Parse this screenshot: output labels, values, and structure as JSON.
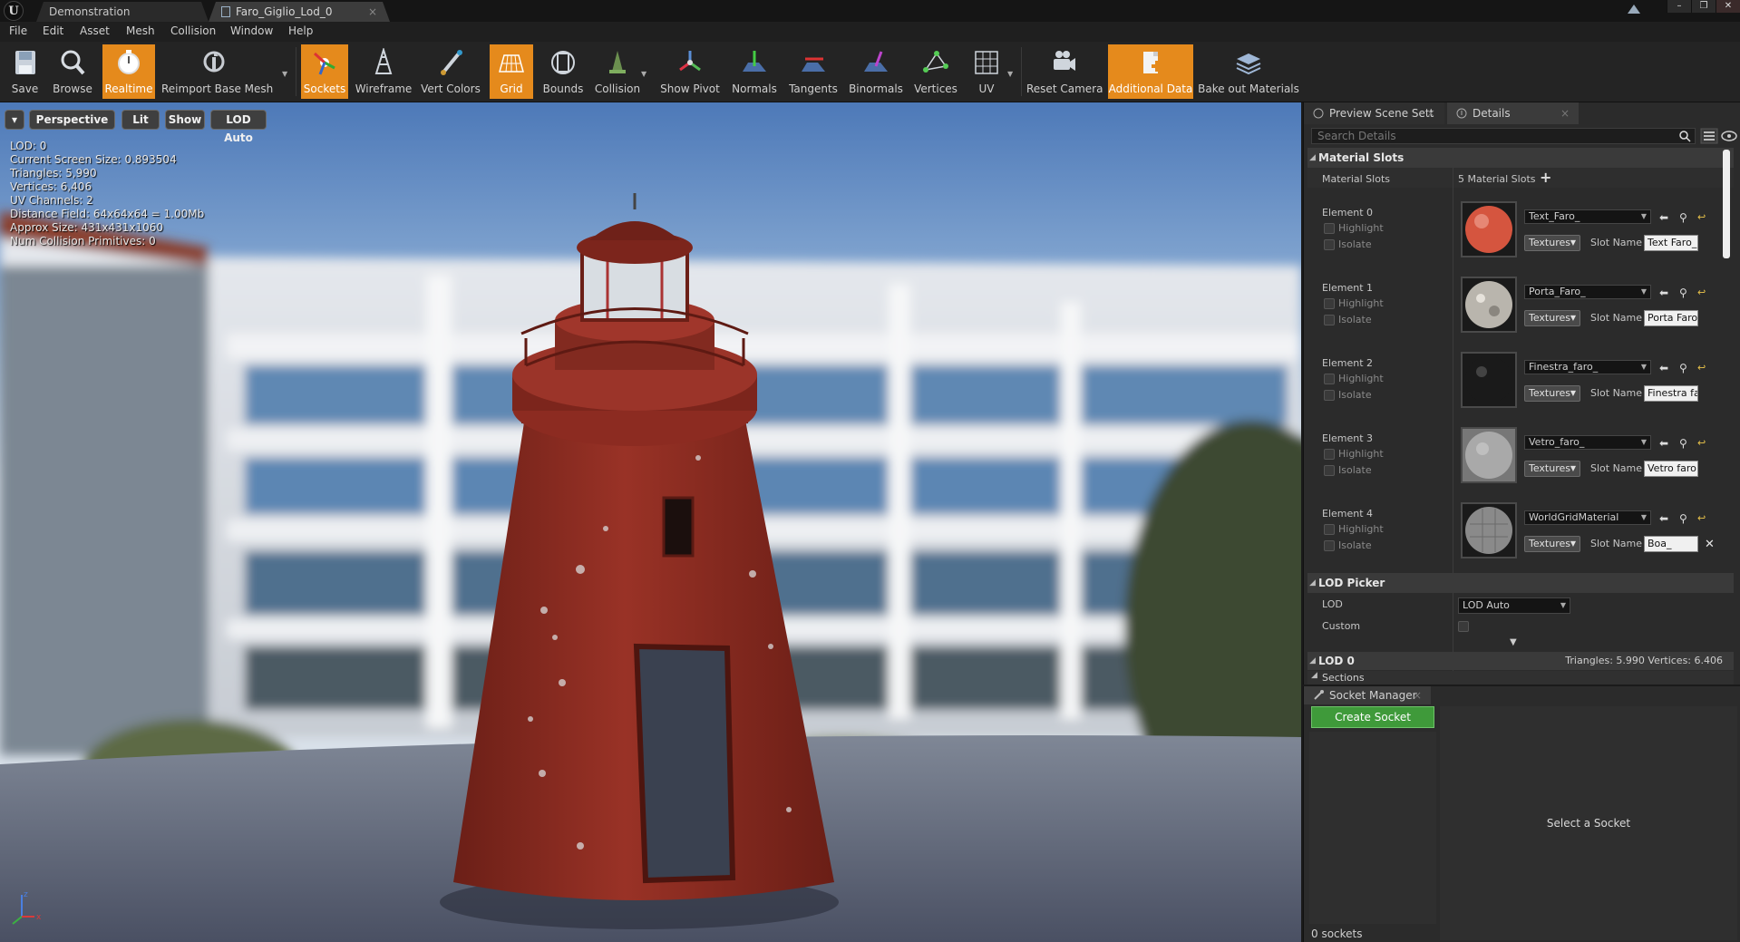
{
  "titlebar": {
    "tabs": [
      {
        "label": "Demonstration"
      },
      {
        "label": "Faro_Giglio_Lod_0"
      }
    ],
    "close_glyph": "×"
  },
  "menu": [
    "File",
    "Edit",
    "Asset",
    "Mesh",
    "Collision",
    "Window",
    "Help"
  ],
  "toolbar": {
    "buttons": [
      {
        "label": "Save",
        "icon": "save-icon",
        "active": false
      },
      {
        "label": "Browse",
        "icon": "browse-icon",
        "active": false
      },
      {
        "label": "Realtime",
        "icon": "realtime-icon",
        "active": true
      },
      {
        "label": "Reimport Base Mesh",
        "icon": "reimport-icon",
        "active": false
      },
      {
        "label": "Sockets",
        "icon": "sockets-icon",
        "active": true
      },
      {
        "label": "Wireframe",
        "icon": "wireframe-icon",
        "active": false
      },
      {
        "label": "Vert Colors",
        "icon": "vert-colors-icon",
        "active": false
      },
      {
        "label": "Grid",
        "icon": "grid-icon",
        "active": true
      },
      {
        "label": "Bounds",
        "icon": "bounds-icon",
        "active": false
      },
      {
        "label": "Collision",
        "icon": "collision-icon",
        "active": false
      },
      {
        "label": "Show Pivot",
        "icon": "pivot-icon",
        "active": false
      },
      {
        "label": "Normals",
        "icon": "normals-icon",
        "active": false
      },
      {
        "label": "Tangents",
        "icon": "tangents-icon",
        "active": false
      },
      {
        "label": "Binormals",
        "icon": "binormals-icon",
        "active": false
      },
      {
        "label": "Vertices",
        "icon": "vertices-icon",
        "active": false
      },
      {
        "label": "UV",
        "icon": "uv-icon",
        "active": false
      },
      {
        "label": "Reset Camera",
        "icon": "camera-icon",
        "active": false
      },
      {
        "label": "Additional Data",
        "icon": "additional-data-icon",
        "active": true
      },
      {
        "label": "Bake out Materials",
        "icon": "bake-icon",
        "active": false
      }
    ]
  },
  "viewport": {
    "perspective_label": "Perspective",
    "lit_label": "Lit",
    "show_label": "Show",
    "lod_label": "LOD Auto",
    "stats": [
      "LOD:  0",
      "Current Screen Size:  0.893504",
      "Triangles:  5,990",
      "Vertices:  6,406",
      "UV Channels:  2",
      "Distance Field:  64x64x64 = 1.00Mb",
      "Approx Size: 431x431x1060",
      "Num Collision Primitives:  0"
    ]
  },
  "details": {
    "tab_scene": "Preview Scene Sett",
    "tab_details": "Details",
    "search_placeholder": "Search Details",
    "material_slots_header": "Material Slots",
    "material_slots_label": "Material Slots",
    "material_slots_count": "5 Material Slots",
    "highlight_label": "Highlight",
    "isolate_label": "Isolate",
    "textures_label": "Textures",
    "slot_name_label": "Slot Name",
    "elements": [
      {
        "label": "Element 0",
        "material": "Text_Faro_",
        "slot": "Text Faro_",
        "color": "#d5553f"
      },
      {
        "label": "Element 1",
        "material": "Porta_Faro_",
        "slot": "Porta Faro",
        "color": "#b9b5ad"
      },
      {
        "label": "Element 2",
        "material": "Finestra_faro_",
        "slot": "Finestra fa",
        "color": "#1a1a1a"
      },
      {
        "label": "Element 3",
        "material": "Vetro_faro_",
        "slot": "Vetro faro",
        "color": "#a9a9a9"
      },
      {
        "label": "Element 4",
        "material": "WorldGridMaterial",
        "slot": "Boa_",
        "color": "#8a8a8a"
      }
    ],
    "lod_picker_header": "LOD Picker",
    "lod_label": "LOD",
    "lod_value": "LOD Auto",
    "custom_label": "Custom",
    "lod0_header": "LOD 0",
    "lod0_stats": "Triangles: 5.990   Vertices: 6.406",
    "sections_label": "Sections"
  },
  "socket_manager": {
    "tab_label": "Socket Manager",
    "create_label": "Create Socket",
    "count_label": "0 sockets",
    "select_label": "Select a Socket"
  },
  "colors": {
    "accent_active": "#e58a1c",
    "create_socket": "#3f9a3a",
    "lighthouse_red": "#8e2d22"
  }
}
